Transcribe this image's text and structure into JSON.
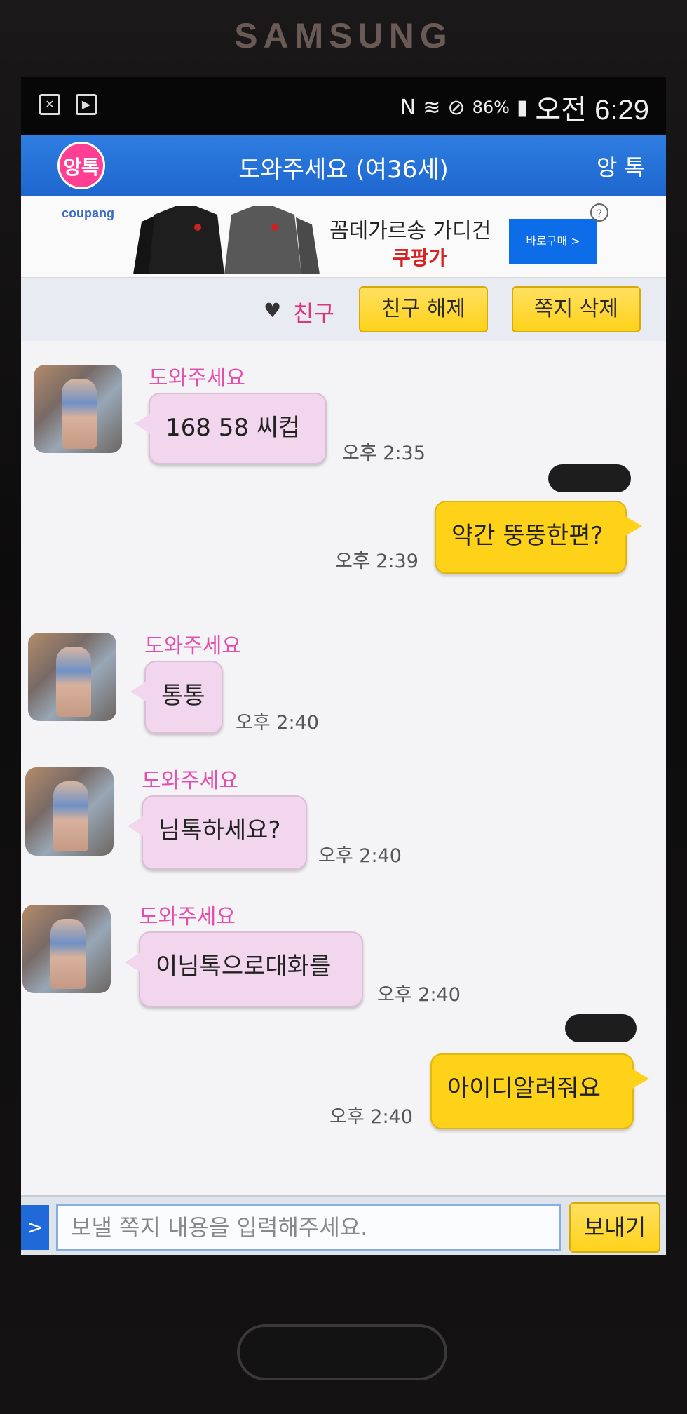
{
  "device": {
    "brand": "SAMSUNG"
  },
  "status_bar": {
    "battery": "86%",
    "time": "오전 6:29"
  },
  "app": {
    "logo_text": "앙톡",
    "title": "도와주세요 (여36세)",
    "brand_right": "앙 톡"
  },
  "ad": {
    "brand": "coupang",
    "headline": "꼼데가르송 가디건",
    "sub": "쿠팡가",
    "button": "바로구매 >",
    "info": "?"
  },
  "actions": {
    "heart": "♥",
    "friend_label": "친구",
    "unfriend": "친구 해제",
    "delete": "쪽지 삭제"
  },
  "messages": [
    {
      "dir": "in",
      "sender": "도와주세요",
      "text": "168  58  씨컵",
      "time": "오후 2:35"
    },
    {
      "dir": "out",
      "text": "약간 뚱뚱한편?",
      "time": "오후 2:39"
    },
    {
      "dir": "in",
      "sender": "도와주세요",
      "text": "통통",
      "time": "오후 2:40"
    },
    {
      "dir": "in",
      "sender": "도와주세요",
      "text": "님톡하세요?",
      "time": "오후 2:40"
    },
    {
      "dir": "in",
      "sender": "도와주세요",
      "text": "이님톡으로대화를",
      "time": "오후 2:40"
    },
    {
      "dir": "out",
      "text": "아이디알려줘요",
      "time": "오후 2:40"
    }
  ],
  "composer": {
    "toggle": ">",
    "placeholder": "보낼 쪽지 내용을 입력해주세요.",
    "send": "보내기"
  },
  "colors": {
    "header_blue": "#1d66cf",
    "incoming_bubble": "#f2d6ee",
    "outgoing_bubble": "#ffd21a",
    "sender_pink": "#e44fae"
  }
}
